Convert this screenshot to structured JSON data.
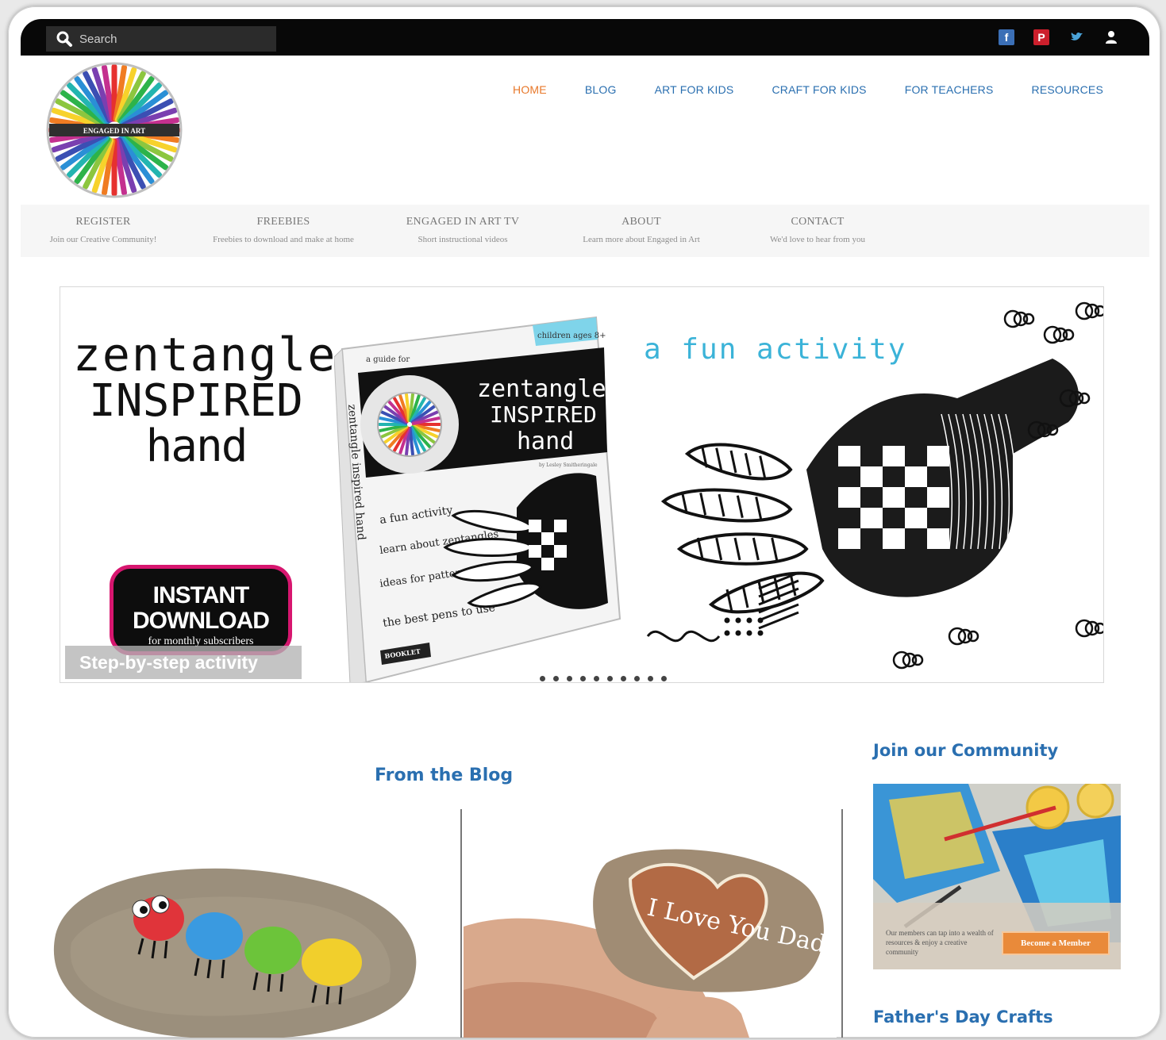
{
  "topbar": {
    "search_placeholder": "Search",
    "social_icons": [
      "facebook-icon",
      "pinterest-icon",
      "twitter-icon",
      "user-icon"
    ]
  },
  "logo": {
    "text": "ENGAGED IN ART"
  },
  "main_nav": [
    {
      "label": "HOME",
      "active": true
    },
    {
      "label": "BLOG",
      "active": false
    },
    {
      "label": "ART FOR KIDS",
      "active": false
    },
    {
      "label": "CRAFT FOR KIDS",
      "active": false
    },
    {
      "label": "FOR TEACHERS",
      "active": false
    },
    {
      "label": "RESOURCES",
      "active": false
    }
  ],
  "sub_nav": [
    {
      "title": "REGISTER",
      "subtitle": "Join our Creative Community!"
    },
    {
      "title": "FREEBIES",
      "subtitle": "Freebies to download and make at home"
    },
    {
      "title": "ENGAGED IN ART TV",
      "subtitle": "Short instructional videos"
    },
    {
      "title": "ABOUT",
      "subtitle": "Learn more about Engaged in Art"
    },
    {
      "title": "CONTACT",
      "subtitle": "We'd love to hear from you"
    }
  ],
  "hero": {
    "title_lines": [
      "zentangle",
      "INSPIRED",
      "hand"
    ],
    "badge_line1": "INSTANT",
    "badge_line2": "DOWNLOAD",
    "badge_line3": "for monthly subscribers",
    "caption": "Step-by-step activity",
    "fun_text": "a fun activity",
    "book": {
      "tag": "children ages 8+",
      "guide": "a guide for",
      "title_lines": [
        "zentangle",
        "INSPIRED",
        "hand"
      ],
      "author": "by Lesley Smitheringale",
      "spine": "zentangle inspired hand",
      "bullets": [
        "a fun activity",
        "learn about zentangles",
        "ideas for patterns included",
        "the best pens to use"
      ],
      "label": "BOOKLET"
    }
  },
  "blog": {
    "title": "From the Blog",
    "post2_text": "I Love You Dad."
  },
  "sidebar": {
    "join_title": "Join our Community",
    "join_text": "Our members can tap into a wealth of resources & enjoy a creative community",
    "join_button": "Become a Member",
    "fathers_title": "Father's Day Crafts"
  },
  "colors": {
    "nav_blue": "#2a6fb0",
    "nav_active": "#e8782a",
    "fun_text": "#3bb3d8",
    "badge_border": "#d7166f",
    "member_button": "#e98a3a"
  }
}
